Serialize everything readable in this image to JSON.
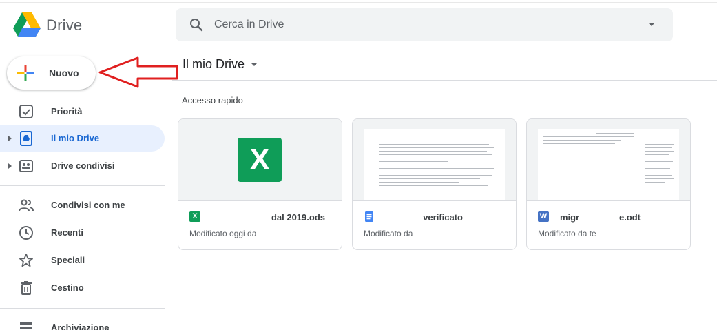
{
  "app": {
    "brand": "Drive",
    "logo_icon": "google-drive-logo"
  },
  "search": {
    "placeholder": "Cerca in Drive"
  },
  "sidebar": {
    "new_label": "Nuovo",
    "items": [
      {
        "label": "Priorità",
        "icon": "checkbox-icon",
        "active": false,
        "expandable": false
      },
      {
        "label": "Il mio Drive",
        "icon": "drive-icon",
        "active": true,
        "expandable": true
      },
      {
        "label": "Drive condivisi",
        "icon": "shared-drive-icon",
        "active": false,
        "expandable": true
      },
      {
        "label": "Condivisi con me",
        "icon": "people-icon",
        "active": false,
        "expandable": false
      },
      {
        "label": "Recenti",
        "icon": "clock-icon",
        "active": false,
        "expandable": false
      },
      {
        "label": "Speciali",
        "icon": "star-icon",
        "active": false,
        "expandable": false
      },
      {
        "label": "Cestino",
        "icon": "trash-icon",
        "active": false,
        "expandable": false
      },
      {
        "label": "Archiviazione",
        "icon": "storage-icon",
        "active": false,
        "expandable": false
      }
    ]
  },
  "main": {
    "title": "Il mio Drive",
    "section": "Accesso rapido",
    "files": [
      {
        "name": "dal 2019.ods",
        "meta": "Modificato oggi da",
        "type_letter": "X",
        "type_color": "#0f9d58"
      },
      {
        "name": "verificato",
        "meta": "Modificato da",
        "type_letter": "≡",
        "type_color": "#4285f4"
      },
      {
        "name": "migr                e.odt",
        "meta": "Modificato da te",
        "type_letter": "W",
        "type_color": "#4472c4"
      }
    ]
  },
  "colors": {
    "accent": "#1967d2",
    "active_bg": "#e8f0fe",
    "annotation_arrow": "#e02020"
  }
}
